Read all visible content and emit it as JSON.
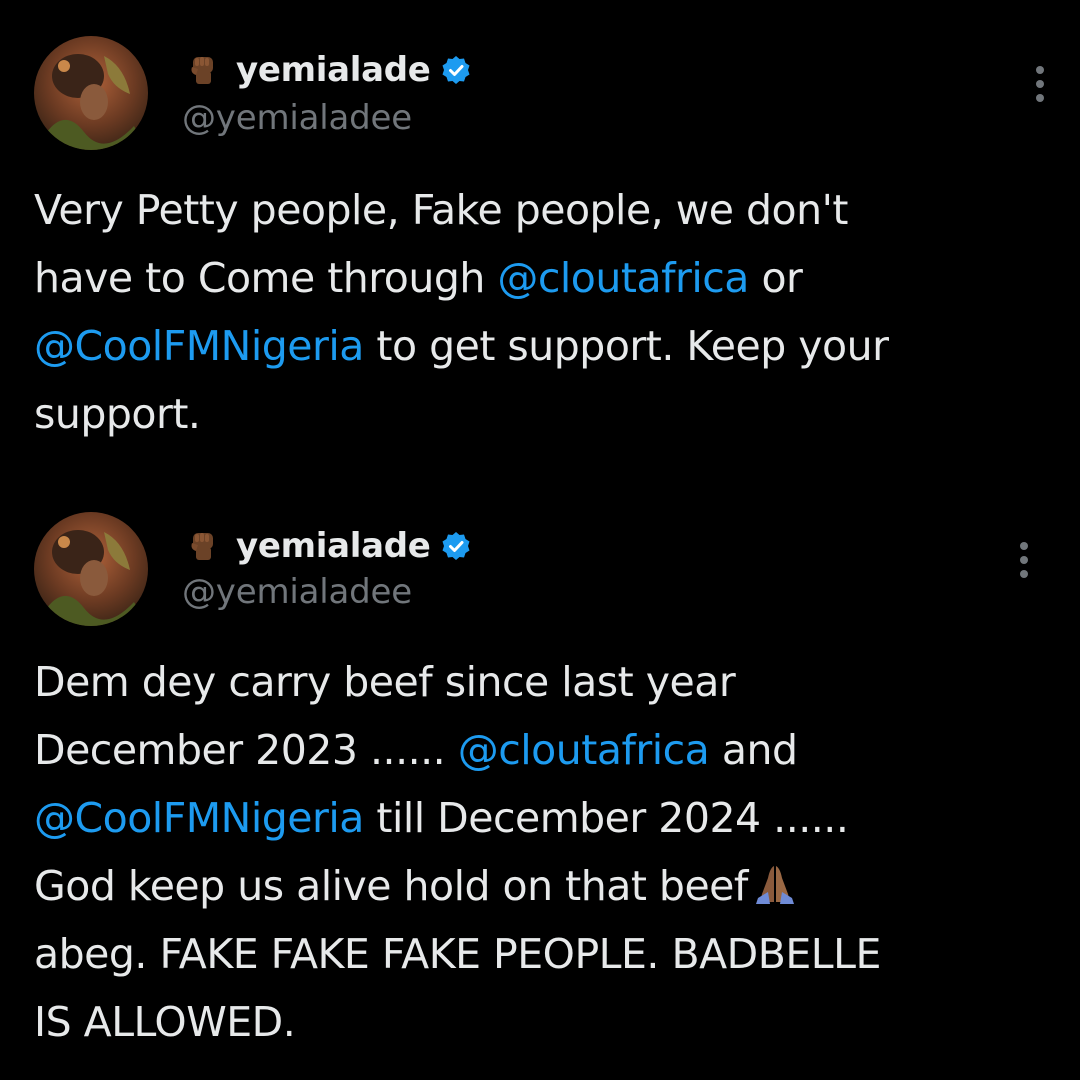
{
  "colors": {
    "background": "#000000",
    "text": "#e7e9ea",
    "secondary": "#71767b",
    "mention": "#1d9bf0",
    "verified": "#1d9bf0"
  },
  "tweets": [
    {
      "display_name": "yemialade",
      "handle": "@yemialadee",
      "name_emoji": "raised-fist-icon",
      "verified": true,
      "text_lines": [
        [
          {
            "t": "Very Petty people, Fake people, we don't"
          }
        ],
        [
          {
            "t": "have to Come through "
          },
          {
            "m": "@cloutafrica"
          },
          {
            "t": " or"
          }
        ],
        [
          {
            "m": "@CoolFMNigeria"
          },
          {
            "t": " to get support. Keep your"
          }
        ],
        [
          {
            "t": "support."
          }
        ]
      ]
    },
    {
      "display_name": "yemialade",
      "handle": "@yemialadee",
      "name_emoji": "raised-fist-icon",
      "verified": true,
      "text_lines": [
        [
          {
            "t": "Dem dey carry beef since last year"
          }
        ],
        [
          {
            "t": "December 2023 ...... "
          },
          {
            "m": "@cloutafrica"
          },
          {
            "t": " and"
          }
        ],
        [
          {
            "m": "@CoolFMNigeria"
          },
          {
            "t": " till December 2024 ......"
          }
        ],
        [
          {
            "t": "God keep us alive hold on that beef"
          },
          {
            "e": "folded-hands-icon"
          }
        ],
        [
          {
            "t": "abeg. FAKE FAKE FAKE PEOPLE. BADBELLE"
          }
        ],
        [
          {
            "t": "IS ALLOWED."
          }
        ]
      ]
    }
  ]
}
